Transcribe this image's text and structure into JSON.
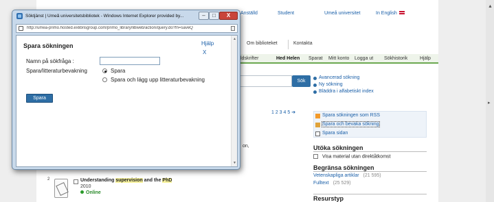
{
  "window": {
    "title": "Söktjänst | Umeå universitetsbibliotek - Windows Internet Explorer provided by...",
    "address": "http://umea-primo.hosted.exlibrisgroup.com/primo_library/libweb/action/query.do?fn=saveQ",
    "minimize": "–",
    "maximize": "□",
    "close": "X"
  },
  "dialog": {
    "title": "Spara sökningen",
    "help": "Hjälp",
    "close": "X",
    "name_label": "Namn på sökfråga :",
    "name_value": "",
    "watch_label": "Spara/litteraturbevakning",
    "options": [
      "Spara",
      "Spara och lägg upp litteraturbevakning"
    ],
    "selected": 0,
    "save_button": "Spara"
  },
  "background": {
    "toplinks": [
      "Anställd",
      "Student",
      "Umeå universitet",
      "In English"
    ],
    "mainnav": [
      "Om biblioteket",
      "Kontakta"
    ],
    "subnav": [
      "ldskrifter",
      "Hed Helen",
      "Sparat",
      "Mitt konto",
      "Logga ut",
      "Sökhistorik",
      "Hjälp"
    ],
    "search_button": "Sök",
    "search_links": [
      "Avancerad sökning",
      "Ny sökning",
      "Bläddra i alfabetiskt index"
    ],
    "pager": "1 2 3 4 5 ➔",
    "actions": [
      "Spara sökningen som RSS",
      "Spara och bevaka sökning",
      "Spara sidan"
    ],
    "fragment": "on,",
    "expand_heading": "Utöka sökningen",
    "expand_item": "Visa material utan direktåtkomst",
    "narrow_heading": "Begränsa sökningen",
    "facets": [
      {
        "label": "Vetenskapliga artiklar",
        "count": "(21 595)"
      },
      {
        "label": "Fulltext",
        "count": "(25 529)"
      }
    ],
    "resource_heading": "Resurstyp",
    "result": {
      "number": "2",
      "title_pre": "Understanding ",
      "title_hl": "supervision",
      "title_mid": " and the ",
      "title_hl2": "PhD",
      "year": "2010",
      "status": "Online"
    }
  },
  "colors": {
    "accent": "#2e6ea5",
    "link": "#1a5fa8",
    "online": "#2a8a2a",
    "nav_underline": "#6aa84f"
  }
}
